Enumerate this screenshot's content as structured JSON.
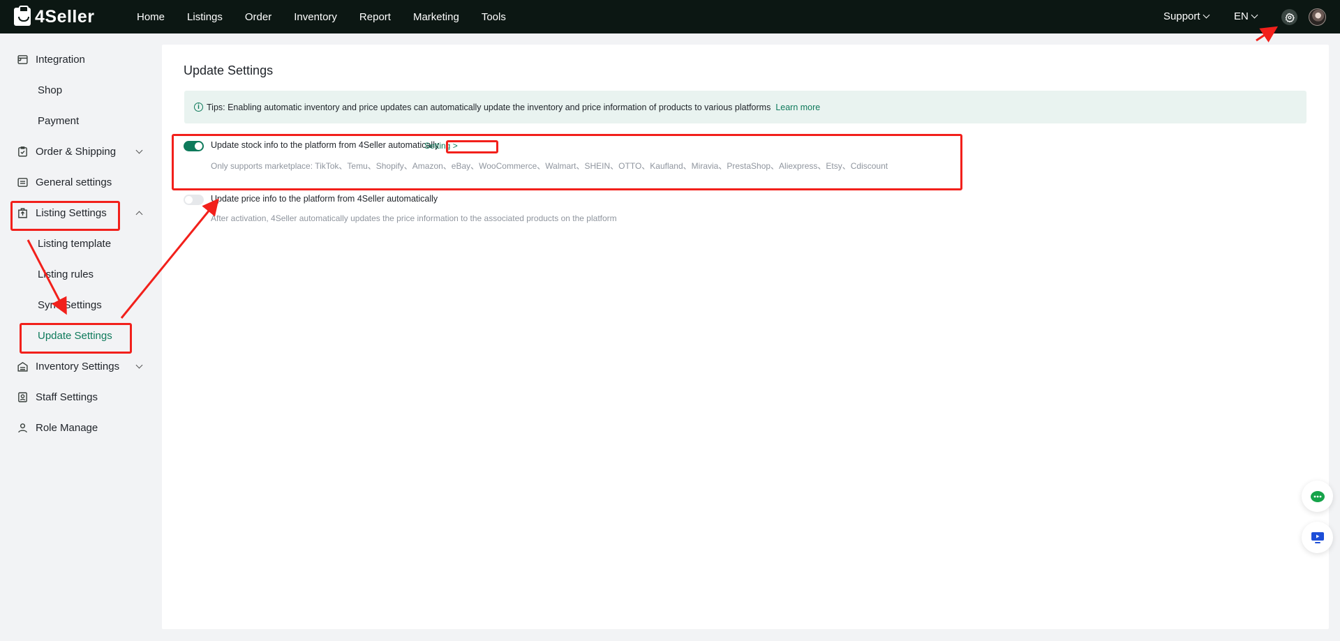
{
  "app": {
    "name": "4Seller"
  },
  "topnav": {
    "items": [
      "Home",
      "Listings",
      "Order",
      "Inventory",
      "Report",
      "Marketing",
      "Tools"
    ],
    "support": "Support",
    "language": "EN"
  },
  "sidebar": {
    "integration": "Integration",
    "shop": "Shop",
    "payment": "Payment",
    "order_shipping": "Order & Shipping",
    "general_settings": "General settings",
    "listing_settings": "Listing Settings",
    "listing_template": "Listing template",
    "listing_rules": "Listing rules",
    "sync_settings": "Sync Settings",
    "update_settings": "Update Settings",
    "inventory_settings": "Inventory Settings",
    "staff_settings": "Staff Settings",
    "role_manage": "Role Manage"
  },
  "main": {
    "title": "Update Settings",
    "tips": {
      "text": "Tips: Enabling automatic inventory and price updates can automatically update the inventory and price information of products to various platforms",
      "learn_more": "Learn more"
    },
    "stock_option": {
      "enabled": true,
      "title": "Update stock info to the platform from 4Seller automatically",
      "setting_link": "Setting >",
      "description": "Only supports marketplace: TikTok、Temu、Shopify、Amazon、eBay、WooCommerce、Walmart、SHEIN、OTTO、Kaufland、Miravia、PrestaShop、Aliexpress、Etsy、Cdiscount"
    },
    "price_option": {
      "enabled": false,
      "title": "Update price info to the platform from 4Seller automatically",
      "description": "After activation, 4Seller automatically updates the price information to the associated products on the platform"
    }
  },
  "colors": {
    "accent": "#0e7a5b",
    "topbar": "#0c1713",
    "annotation": "#f2201b"
  }
}
